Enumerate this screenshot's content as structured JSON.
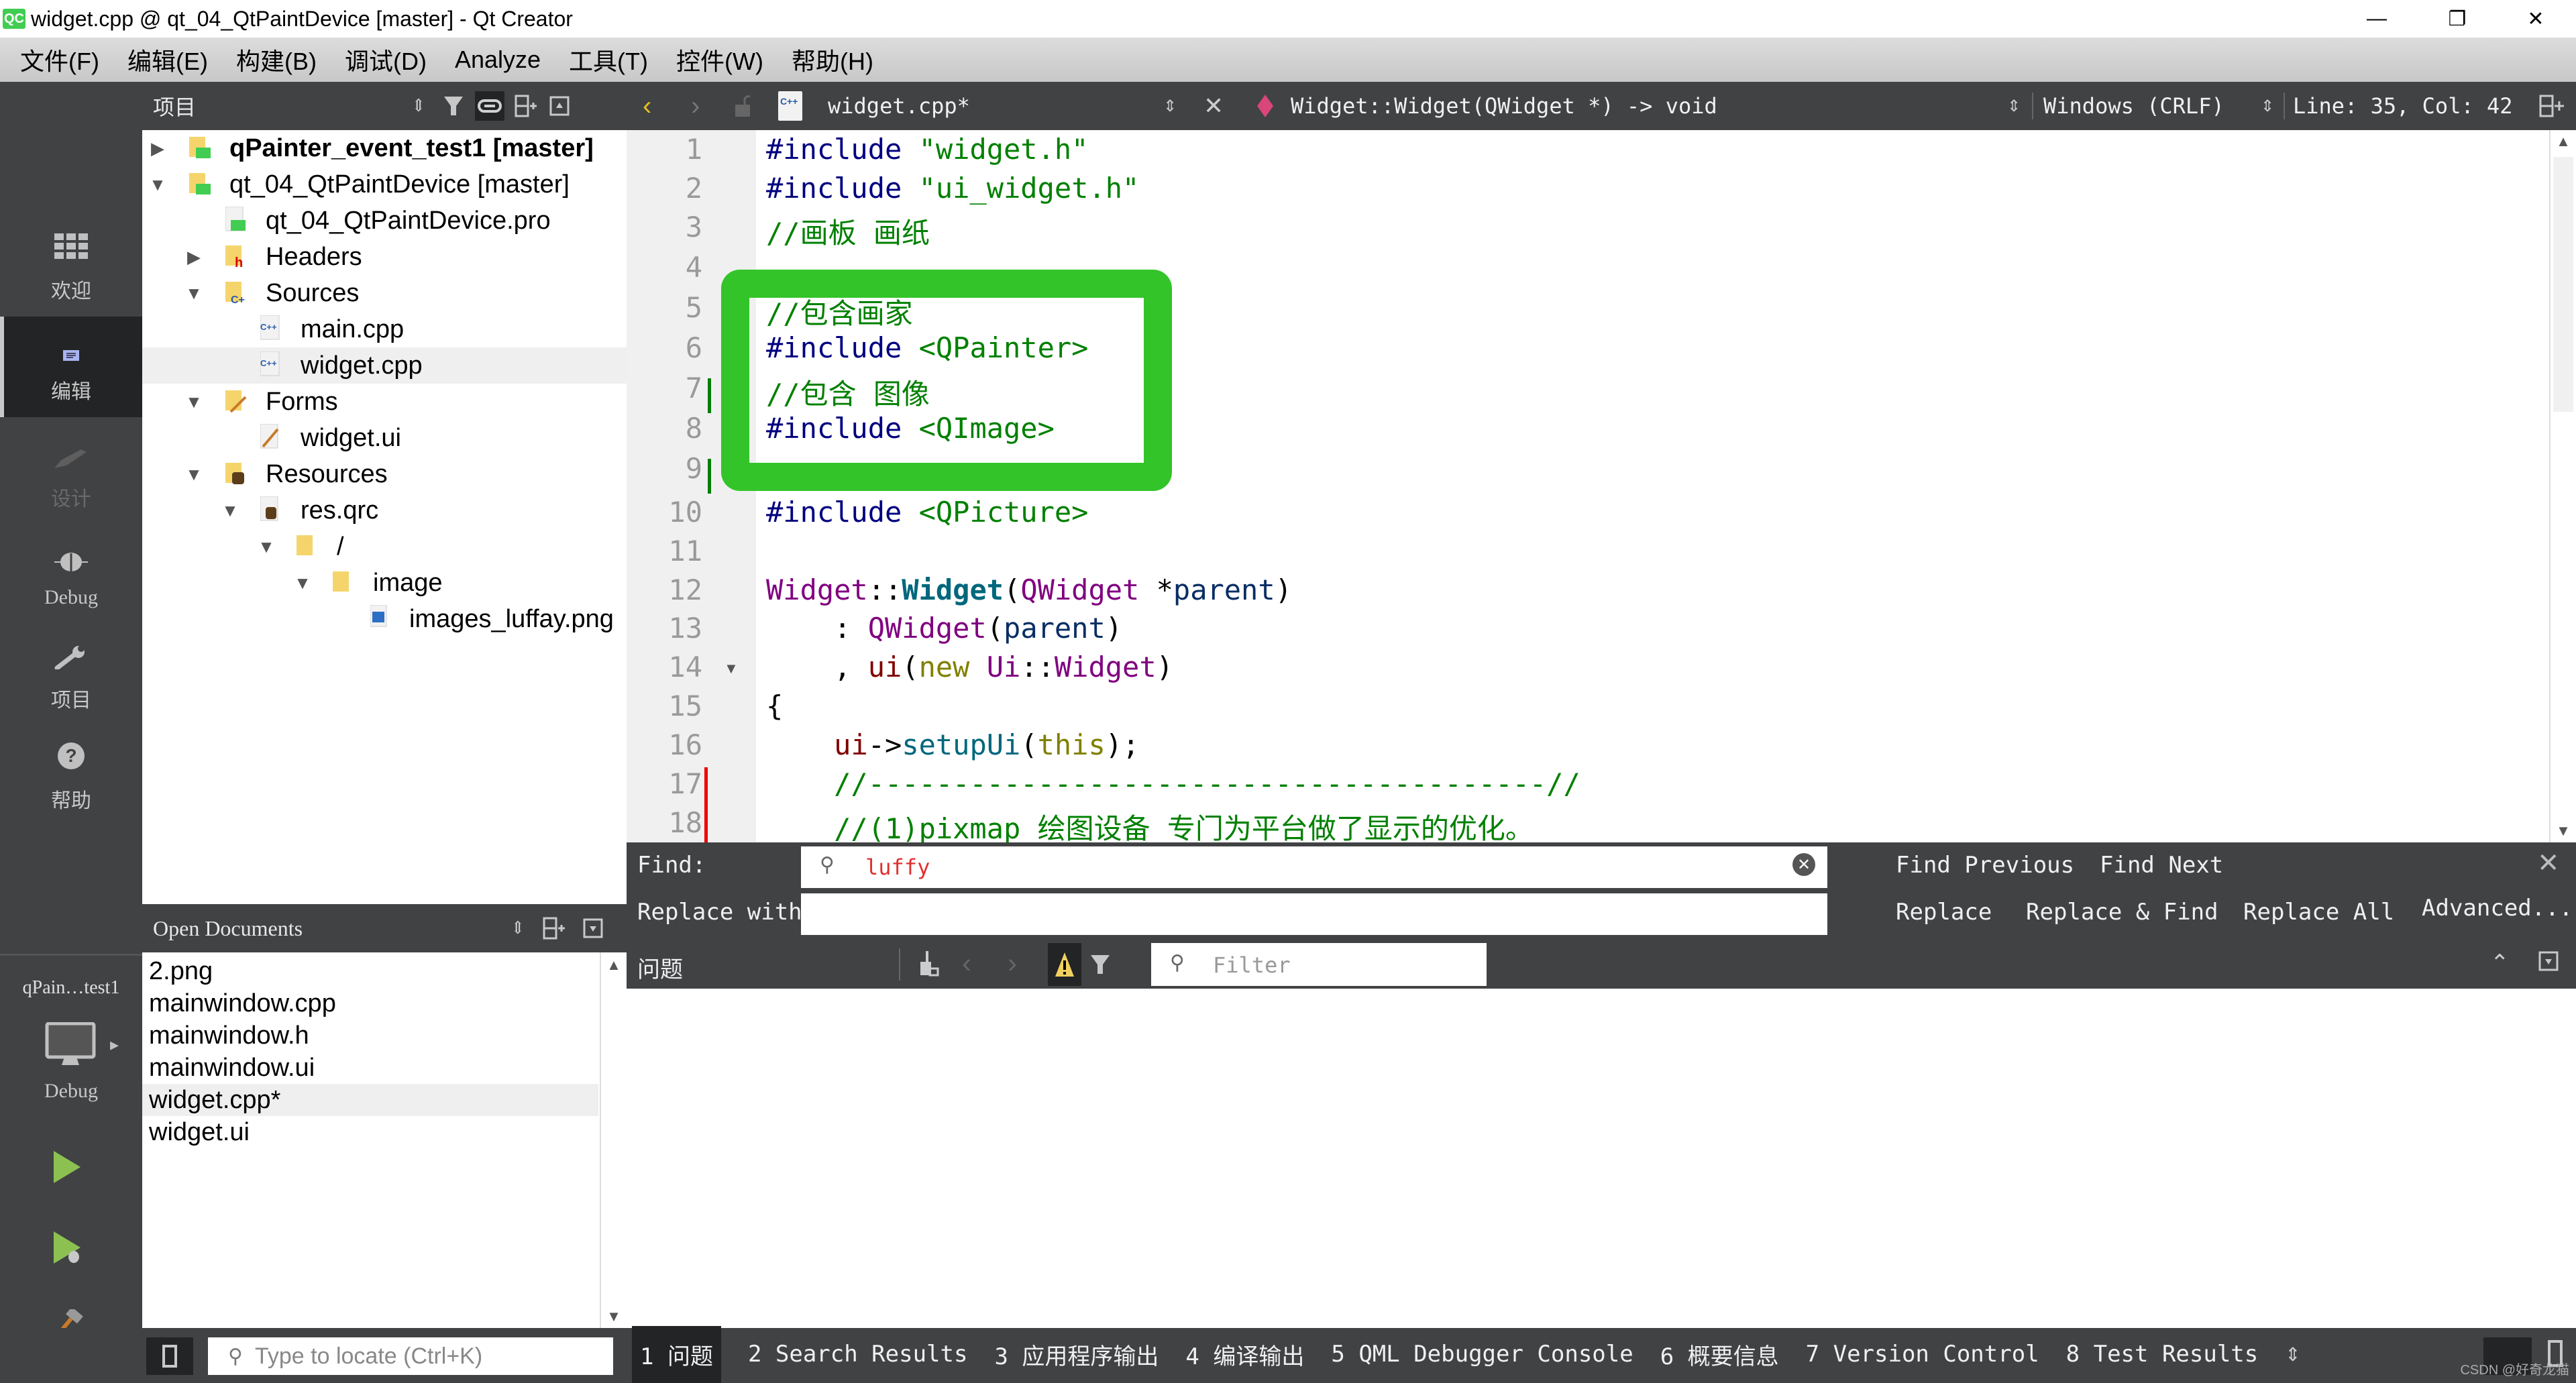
{
  "window": {
    "title": "widget.cpp @ qt_04_QtPaintDevice [master] - Qt Creator",
    "app_icon": "qc-logo-icon",
    "minimize": "—",
    "restore": "❐",
    "close": "✕"
  },
  "menu": [
    "文件(F)",
    "编辑(E)",
    "构建(B)",
    "调试(D)",
    "Analyze",
    "工具(T)",
    "控件(W)",
    "帮助(H)"
  ],
  "modes": [
    {
      "label": "欢迎",
      "icon": "▦"
    },
    {
      "label": "编辑",
      "icon": "▤"
    },
    {
      "label": "设计",
      "icon": "✎"
    },
    {
      "label": "Debug",
      "icon": "✱"
    },
    {
      "label": "项目",
      "icon": "🔧"
    },
    {
      "label": "帮助",
      "icon": "?"
    }
  ],
  "kit": {
    "project": "qPain…test1",
    "config": "Debug"
  },
  "project_panel": {
    "title": "项目",
    "tree": [
      {
        "label": "qPainter_event_test1 [master]",
        "bold": true,
        "expanded": false,
        "depth": 0
      },
      {
        "label": "qt_04_QtPaintDevice [master]",
        "expanded": true,
        "depth": 0
      },
      {
        "label": "qt_04_QtPaintDevice.pro",
        "depth": 1
      },
      {
        "label": "Headers",
        "expanded": false,
        "depth": 1
      },
      {
        "label": "Sources",
        "expanded": true,
        "depth": 1
      },
      {
        "label": "main.cpp",
        "depth": 2
      },
      {
        "label": "widget.cpp",
        "depth": 2,
        "selected": true
      },
      {
        "label": "Forms",
        "expanded": true,
        "depth": 1
      },
      {
        "label": "widget.ui",
        "depth": 2
      },
      {
        "label": "Resources",
        "expanded": true,
        "depth": 1
      },
      {
        "label": "res.qrc",
        "expanded": true,
        "depth": 2
      },
      {
        "label": "/",
        "expanded": true,
        "depth": 3
      },
      {
        "label": "image",
        "expanded": true,
        "depth": 4
      },
      {
        "label": "images_luffay.png",
        "depth": 5
      }
    ]
  },
  "open_documents": {
    "title": "Open Documents",
    "items": [
      "2.png",
      "mainwindow.cpp",
      "mainwindow.h",
      "mainwindow.ui",
      "widget.cpp*",
      "widget.ui"
    ],
    "selected": "widget.cpp*"
  },
  "locator": {
    "placeholder": "Type to locate (Ctrl+K)"
  },
  "editor_toolbar": {
    "file": "widget.cpp*",
    "symbol": "Widget::Widget(QWidget *) -> void",
    "line_endings": "Windows (CRLF)",
    "position": "Line: 35, Col: 42"
  },
  "code_lines": [
    {
      "n": "1",
      "text": "#include \"widget.h\""
    },
    {
      "n": "2",
      "text": "#include \"ui_widget.h\""
    },
    {
      "n": "3",
      "text": "//画板 画纸"
    },
    {
      "n": "4",
      "text": ""
    },
    {
      "n": "5",
      "text": "//包含画家"
    },
    {
      "n": "6",
      "text": "#include <QPainter>"
    },
    {
      "n": "7",
      "text": "//包含 图像"
    },
    {
      "n": "8",
      "text": "#include <QImage>"
    },
    {
      "n": "9",
      "text": ""
    },
    {
      "n": "10",
      "text": "#include <QPicture>"
    },
    {
      "n": "11",
      "text": ""
    },
    {
      "n": "12",
      "text": "Widget::Widget(QWidget *parent)"
    },
    {
      "n": "13",
      "text": "    : QWidget(parent)"
    },
    {
      "n": "14",
      "text": "    , ui(new Ui::Widget)"
    },
    {
      "n": "15",
      "text": "{"
    },
    {
      "n": "16",
      "text": "    ui->setupUi(this);"
    },
    {
      "n": "17",
      "text": "    //----------------------------------------//"
    },
    {
      "n": "18",
      "text": "    //(1)pixmap 绘图设备 专门为平台做了显示的优化。"
    }
  ],
  "find": {
    "find_label": "Find:",
    "find_value": "luffy",
    "replace_label": "Replace with:",
    "replace_value": "",
    "find_previous": "Find Previous",
    "find_next": "Find Next",
    "replace": "Replace",
    "replace_find": "Replace & Find",
    "replace_all": "Replace All",
    "advanced": "Advanced..."
  },
  "issues": {
    "title": "问题",
    "filter_placeholder": "Filter"
  },
  "output_tabs": [
    "1 问题",
    "2 Search Results",
    "3 应用程序输出",
    "4 编译输出",
    "5 QML Debugger Console",
    "6 概要信息",
    "7 Version Control",
    "8 Test Results"
  ],
  "watermark": "CSDN @好奇龙猫"
}
